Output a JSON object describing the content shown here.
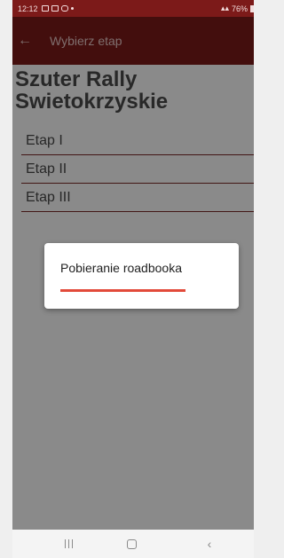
{
  "status_bar": {
    "time": "12:12",
    "battery": "76%"
  },
  "app_bar": {
    "title": "Wybierz etap",
    "back_icon": "←"
  },
  "rally": {
    "title": "Szuter Rally Swietokrzyskie",
    "stages": [
      "Etap I",
      "Etap II",
      "Etap III"
    ]
  },
  "dialog": {
    "message": "Pobieranie roadbooka",
    "progress": 1.0
  },
  "nav": {
    "back_icon": "‹"
  },
  "colors": {
    "accent": "#7c1a19",
    "progress": "#e24a3a"
  }
}
